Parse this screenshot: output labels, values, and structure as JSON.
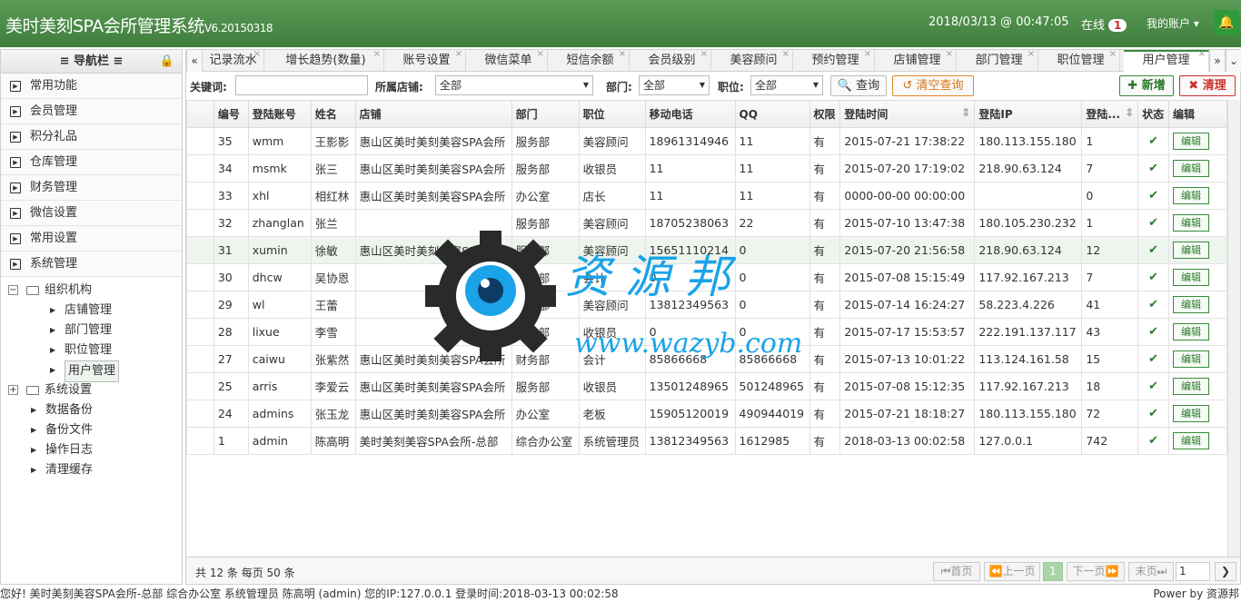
{
  "header": {
    "title": "美时美刻SPA会所管理系统",
    "version": "V6.20150318",
    "datetime": "2018/03/13 @ 00:47:05",
    "online_label": "在线",
    "online_count": "1",
    "account_label": "我的账户"
  },
  "sidebar": {
    "title": "≡ 导航栏 ≡",
    "menus": [
      "常用功能",
      "会员管理",
      "积分礼品",
      "仓库管理",
      "财务管理",
      "微信设置",
      "常用设置",
      "系统管理"
    ],
    "tree": {
      "org": "组织机构",
      "org_children": [
        "店铺管理",
        "部门管理",
        "职位管理",
        "用户管理"
      ],
      "sys": "系统设置",
      "sys_children": [
        "数据备份",
        "备份文件",
        "操作日志",
        "清理缓存"
      ]
    }
  },
  "tabs": [
    "记录流水",
    "增长趋势(数量)",
    "账号设置",
    "微信菜单",
    "短信余额",
    "会员级别",
    "美容顾问",
    "预约管理",
    "店铺管理",
    "部门管理",
    "职位管理",
    "用户管理"
  ],
  "toolbar": {
    "keyword_label": "关键词:",
    "keyword_value": "",
    "store_label": "所属店铺:",
    "store_value": "全部",
    "dept_label": "部门:",
    "dept_value": "全部",
    "pos_label": "职位:",
    "pos_value": "全部",
    "search": "查询",
    "clear": "清空查询",
    "add": "新增",
    "delete": "清理"
  },
  "table": {
    "headers": [
      "编号",
      "登陆账号",
      "姓名",
      "店铺",
      "部门",
      "职位",
      "移动电话",
      "QQ",
      "权限",
      "登陆时间",
      "登陆IP",
      "登陆...",
      "状态",
      "编辑"
    ],
    "edit_label": "编辑",
    "rows": [
      [
        "35",
        "wmm",
        "王影影",
        "惠山区美时美刻美容SPA会所",
        "服务部",
        "美容顾问",
        "18961314946",
        "11",
        "有",
        "2015-07-21 17:38:22",
        "180.113.155.180",
        "1"
      ],
      [
        "34",
        "msmk",
        "张三",
        "惠山区美时美刻美容SPA会所",
        "服务部",
        "收银员",
        "11",
        "11",
        "有",
        "2015-07-20 17:19:02",
        "218.90.63.124",
        "7"
      ],
      [
        "33",
        "xhl",
        "相红林",
        "惠山区美时美刻美容SPA会所",
        "办公室",
        "店长",
        "11",
        "11",
        "有",
        "0000-00-00 00:00:00",
        "",
        "0"
      ],
      [
        "32",
        "zhanglan",
        "张兰",
        "",
        "服务部",
        "美容顾问",
        "18705238063",
        "22",
        "有",
        "2015-07-10 13:47:38",
        "180.105.230.232",
        "1"
      ],
      [
        "31",
        "xumin",
        "徐敏",
        "惠山区美时美刻美容SPA会所",
        "服务部",
        "美容顾问",
        "15651110214",
        "0",
        "有",
        "2015-07-20 21:56:58",
        "218.90.63.124",
        "12"
      ],
      [
        "30",
        "dhcw",
        "吴协恩",
        "",
        "财务部",
        "会计",
        "0",
        "0",
        "有",
        "2015-07-08 15:15:49",
        "117.92.167.213",
        "7"
      ],
      [
        "29",
        "wl",
        "王蕾",
        "",
        "服务部",
        "美容顾问",
        "13812349563",
        "0",
        "有",
        "2015-07-14 16:24:27",
        "58.223.4.226",
        "41"
      ],
      [
        "28",
        "lixue",
        "李雪",
        "",
        "财务部",
        "收银员",
        "0",
        "0",
        "有",
        "2015-07-17 15:53:57",
        "222.191.137.117",
        "43"
      ],
      [
        "27",
        "caiwu",
        "张紫然",
        "惠山区美时美刻美容SPA会所",
        "财务部",
        "会计",
        "85866668",
        "85866668",
        "有",
        "2015-07-13 10:01:22",
        "113.124.161.58",
        "15"
      ],
      [
        "25",
        "arris",
        "李爱云",
        "惠山区美时美刻美容SPA会所",
        "服务部",
        "收银员",
        "13501248965",
        "501248965",
        "有",
        "2015-07-08 15:12:35",
        "117.92.167.213",
        "18"
      ],
      [
        "24",
        "admins",
        "张玉龙",
        "惠山区美时美刻美容SPA会所",
        "办公室",
        "老板",
        "15905120019",
        "490944019",
        "有",
        "2015-07-21 18:18:27",
        "180.113.155.180",
        "72"
      ],
      [
        "1",
        "admin",
        "陈高明",
        "美时美刻美容SPA会所-总部",
        "综合办公室",
        "系统管理员",
        "13812349563",
        "1612985",
        "有",
        "2018-03-13 00:02:58",
        "127.0.0.1",
        "742"
      ]
    ]
  },
  "pager": {
    "summary": "共 12 条 每页 50 条",
    "first": "首页",
    "prev": "上一页",
    "current": "1",
    "next": "下一页",
    "last": "末页",
    "page_input": "1"
  },
  "status": {
    "left": "您好! 美时美刻美容SPA会所-总部 综合办公室 系统管理员 陈高明 (admin) 您的IP:127.0.0.1 登录时间:2018-03-13 00:02:58",
    "right": "Power by 资源邦"
  },
  "watermark": {
    "cn": "资 源 邦",
    "url": "www.wazyb.com"
  },
  "colors": {
    "header_green": "#4a8c47",
    "accent_green": "#3a8a3a",
    "danger_red": "#c9302c",
    "warn_orange": "#e08a2e",
    "watermark_blue": "#1aa3e8"
  }
}
